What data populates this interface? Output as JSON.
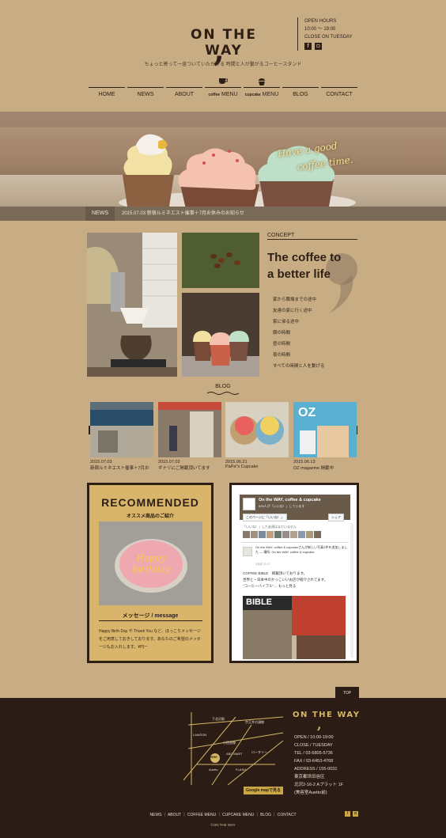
{
  "header": {
    "logo": "ON THE WAY",
    "tagline": "ちょっと寄って一息ついていただける 時間と人が繋がるコーヒースタンド",
    "hours": {
      "label": "OPEN HOURS",
      "time": "10:00 ～ 19:00",
      "closed": "CLOSE ON TUESDAY"
    },
    "social": [
      {
        "icon": "facebook-icon",
        "glyph": "f"
      },
      {
        "icon": "instagram-icon",
        "glyph": "◘"
      }
    ]
  },
  "nav": {
    "items": [
      {
        "label": "HOME"
      },
      {
        "label": "NEWS"
      },
      {
        "label": "ABOUT"
      },
      {
        "label": "MENU",
        "prefix": "coffee"
      },
      {
        "label": "MENU",
        "prefix": "cupcake"
      },
      {
        "label": "BLOG"
      },
      {
        "label": "CONTACT"
      }
    ]
  },
  "hero": {
    "line1": "Have a good",
    "line2": "coffee time."
  },
  "news": {
    "label": "NEWS",
    "text": "2015.07.03 新宿ルミネエスト催事＋7月お休みのお知らせ"
  },
  "concept": {
    "label": "CONCEPT",
    "title_line1": "The coffee to",
    "title_line2": "a better life",
    "items": [
      "家から職場までの途中",
      "友達の家に行く途中",
      "家に帰る途中",
      "朝の時間",
      "昼の時間",
      "夜の時間",
      "すべての時間と人を繋げる"
    ]
  },
  "blog": {
    "label": "BLOG",
    "posts": [
      {
        "date": "2015.07.03",
        "title": "新宿ルミネエスト催事＋7月お"
      },
      {
        "date": "2015.07.03",
        "title": "ギナリにご掲載頂いてます"
      },
      {
        "date": "2015.06.21",
        "title": "PaPa\"s Cupcake"
      },
      {
        "date": "2015.06.13",
        "title": "OZ magazine 掲載中"
      }
    ]
  },
  "recommended": {
    "title": "RECOMMENDED",
    "subtitle": "オススメ商品のご紹介",
    "cake_text": "Happy Birthday",
    "message_title": "メッセージ / message",
    "message_text": "Happy Birth Day や Thank You など、ほっこりメッセージをご用意しておきしております。あなたのご希望のメッセージもお入れします。¥円ー"
  },
  "facebook": {
    "page_name": "On the WAY, coffee & cupcake",
    "likes": "925人が「いいね！」しています",
    "like_btn": "このページに「いいね！」",
    "share_btn": "シェア",
    "friends_text": "「いいね！」した友達はまだいません",
    "post_author": "On the WAY, coffee & cupcakeさんが新しい写真2件を追加しました — 場所: On the WAY, coffee & cupcake",
    "post_date": "2月前 21:17",
    "post_line1": "COFFEE BIBLE　掲載頂いております。",
    "post_line2": "世界と・日本中のかっこいいお店が紹介されてます。",
    "post_line3": "\"コーヒーバイブル\"… もっと見る",
    "photo_text": "BIBLE"
  },
  "footer": {
    "top": "TOP",
    "logo": "ON THE WAY",
    "info": [
      "OPEN / 10:00-19:00",
      "CLOSE / TUESDAY",
      "TEL / 03-6805-5736",
      "FAX / 03-6453-4768",
      "ADDRESS / 155-0031",
      "東京都世田谷区",
      "北沢2-16-2 Aプラット 1F",
      "(美容室Auetto前)"
    ],
    "map_labels": [
      "下北沢駅",
      "LAWSON",
      "小田急線",
      "京王井の頭線",
      "FLASH",
      "Auetto",
      "ABC MART",
      "ロータリー"
    ],
    "map_here": "HERE",
    "gmap": "Google mapで見る",
    "nav": "NEWS ｜ ABOUT ｜ COFFEE MENU ｜ CUPCAKE MENU ｜ BLOG ｜ CONTACT",
    "copyright": "©ON THE WAY"
  }
}
